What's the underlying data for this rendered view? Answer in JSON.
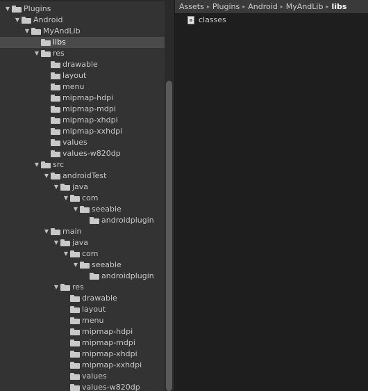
{
  "breadcrumb": {
    "items": [
      "Assets",
      "Plugins",
      "Android",
      "MyAndLib",
      "libs"
    ],
    "separator": "▸"
  },
  "files": [
    {
      "name": "classes",
      "icon": "document-icon"
    }
  ],
  "tree": [
    {
      "label": "Plugins",
      "depth": 0,
      "expanded": true
    },
    {
      "label": "Android",
      "depth": 1,
      "expanded": true
    },
    {
      "label": "MyAndLib",
      "depth": 2,
      "expanded": true
    },
    {
      "label": "libs",
      "depth": 3,
      "expanded": null,
      "selected": true
    },
    {
      "label": "res",
      "depth": 3,
      "expanded": true
    },
    {
      "label": "drawable",
      "depth": 4,
      "expanded": null
    },
    {
      "label": "layout",
      "depth": 4,
      "expanded": null
    },
    {
      "label": "menu",
      "depth": 4,
      "expanded": null
    },
    {
      "label": "mipmap-hdpi",
      "depth": 4,
      "expanded": null
    },
    {
      "label": "mipmap-mdpi",
      "depth": 4,
      "expanded": null
    },
    {
      "label": "mipmap-xhdpi",
      "depth": 4,
      "expanded": null
    },
    {
      "label": "mipmap-xxhdpi",
      "depth": 4,
      "expanded": null
    },
    {
      "label": "values",
      "depth": 4,
      "expanded": null
    },
    {
      "label": "values-w820dp",
      "depth": 4,
      "expanded": null
    },
    {
      "label": "src",
      "depth": 3,
      "expanded": true
    },
    {
      "label": "androidTest",
      "depth": 4,
      "expanded": true
    },
    {
      "label": "java",
      "depth": 5,
      "expanded": true
    },
    {
      "label": "com",
      "depth": 6,
      "expanded": true
    },
    {
      "label": "seeable",
      "depth": 7,
      "expanded": true
    },
    {
      "label": "androidplugin",
      "depth": 8,
      "expanded": null
    },
    {
      "label": "main",
      "depth": 4,
      "expanded": true
    },
    {
      "label": "java",
      "depth": 5,
      "expanded": true
    },
    {
      "label": "com",
      "depth": 6,
      "expanded": true
    },
    {
      "label": "seeable",
      "depth": 7,
      "expanded": true
    },
    {
      "label": "androidplugin",
      "depth": 8,
      "expanded": null
    },
    {
      "label": "res",
      "depth": 5,
      "expanded": true
    },
    {
      "label": "drawable",
      "depth": 6,
      "expanded": null
    },
    {
      "label": "layout",
      "depth": 6,
      "expanded": null
    },
    {
      "label": "menu",
      "depth": 6,
      "expanded": null
    },
    {
      "label": "mipmap-hdpi",
      "depth": 6,
      "expanded": null
    },
    {
      "label": "mipmap-mdpi",
      "depth": 6,
      "expanded": null
    },
    {
      "label": "mipmap-xhdpi",
      "depth": 6,
      "expanded": null
    },
    {
      "label": "mipmap-xxhdpi",
      "depth": 6,
      "expanded": null
    },
    {
      "label": "values",
      "depth": 6,
      "expanded": null
    },
    {
      "label": "values-w820dp",
      "depth": 6,
      "expanded": null
    }
  ]
}
